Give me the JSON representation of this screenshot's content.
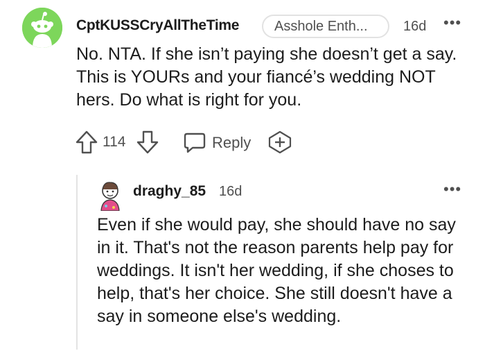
{
  "comment": {
    "username": "CptKUSSCryAllTheTime",
    "flair": "Asshole Enth...",
    "time": "16d",
    "more_label": "•••",
    "body": "No. NTA. If she isn’t paying she doesn’t get a say. This is YOURs and your fiancé’s wedding NOT hers. Do what is right for you.",
    "score": "114",
    "reply_label": "Reply",
    "icons": {
      "avatar": "snoo-avatar",
      "upvote": "upvote-arrow-icon",
      "downvote": "downvote-arrow-icon",
      "reply": "speech-bubble-icon",
      "award": "award-plus-icon"
    }
  },
  "reply": {
    "username": "draghy_85",
    "time": "16d",
    "more_label": "•••",
    "body": "Even if she would pay, she should have no say in it. That's not the reason parents help pay for weddings. It isn't her wedding, if she choses to help, that's her choice. She still doesn't have a say in someone else's wedding."
  },
  "colors": {
    "avatar_bg": "#7dd65b",
    "meta_text": "#505050",
    "body_text": "#1c1c1c",
    "thread_line": "#e3e3e3"
  }
}
